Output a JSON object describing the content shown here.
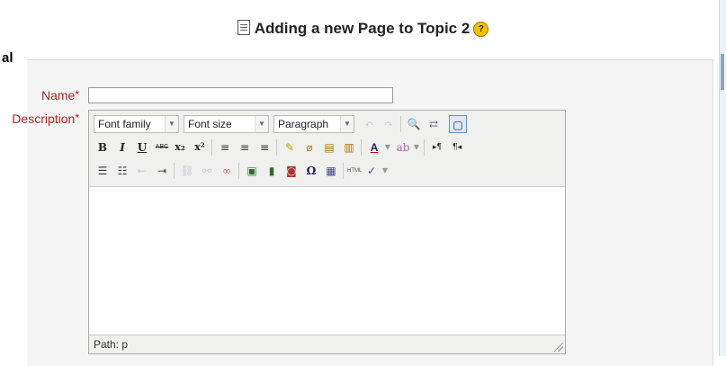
{
  "header": {
    "title": "Adding a new Page to Topic 2"
  },
  "section": {
    "legend": "al"
  },
  "form": {
    "name_label": "Name",
    "description_label": "Description",
    "required_mark": "*",
    "name_value": ""
  },
  "editor": {
    "font_family": "Font family",
    "font_size": "Font size",
    "format": "Paragraph",
    "path": "Path: p",
    "toolbar_row2": {
      "bold": "B",
      "italic": "I",
      "underline": "U",
      "strike": "ABC",
      "sub": "x₂",
      "sup": "x²",
      "forecolor": "A"
    },
    "toolbar_row3": {
      "charmap": "Ω"
    }
  },
  "colors": {
    "label": "#a52a2a",
    "required": "#cc0000",
    "help": "#f2c200"
  }
}
